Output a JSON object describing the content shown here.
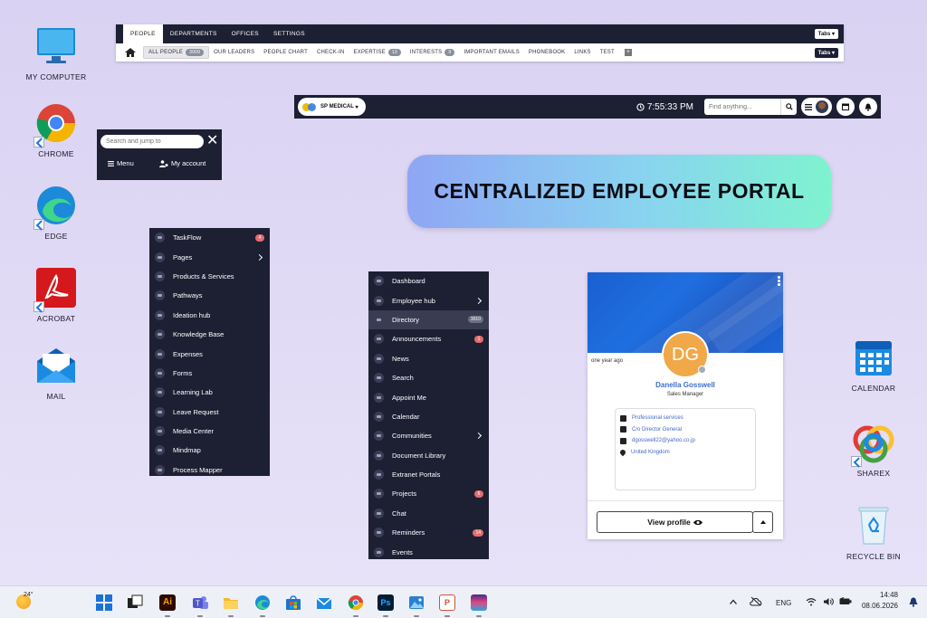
{
  "desktop": {
    "left_icons": [
      {
        "label": "MY COMPUTER"
      },
      {
        "label": "CHROME"
      },
      {
        "label": "EDGE"
      },
      {
        "label": "ACROBAT"
      },
      {
        "label": "MAIL"
      }
    ],
    "right_icons": [
      {
        "label": "CALENDAR"
      },
      {
        "label": "SHAREX"
      },
      {
        "label": "RECYCLE BIN"
      }
    ]
  },
  "tabs_bar": {
    "row1": [
      "PEOPLE",
      "DEPARTMENTS",
      "OFFICES",
      "SETTINGS"
    ],
    "row1_dropdown": "Tabs",
    "row2": [
      {
        "label": "ALL PEOPLE",
        "count": "3009"
      },
      {
        "label": "OUR LEADERS"
      },
      {
        "label": "PEOPLE CHART"
      },
      {
        "label": "CHECK-IN"
      },
      {
        "label": "EXPERTISE",
        "count": "13"
      },
      {
        "label": "INTERESTS",
        "count": "9"
      },
      {
        "label": "IMPORTANT EMAILS"
      },
      {
        "label": "PHONEBOOK"
      },
      {
        "label": "LINKS"
      },
      {
        "label": "TEST"
      }
    ],
    "row2_dropdown": "Tabs"
  },
  "header": {
    "brand": "SP MEDICAL",
    "time": "7:55:33 PM",
    "search_placeholder": "Find anything..."
  },
  "jump": {
    "placeholder": "Search and jump to",
    "menu_label": "Menu",
    "account_label": "My account"
  },
  "banner": {
    "title": "CENTRALIZED EMPLOYEE PORTAL"
  },
  "menu_left": {
    "items": [
      {
        "label": "TaskFlow",
        "badge": "4"
      },
      {
        "label": "Pages",
        "chevron": true
      },
      {
        "label": "Products & Services"
      },
      {
        "label": "Pathways"
      },
      {
        "label": "Ideation hub"
      },
      {
        "label": "Knowledge Base"
      },
      {
        "label": "Expenses"
      },
      {
        "label": "Forms"
      },
      {
        "label": "Learning Lab"
      },
      {
        "label": "Leave Request"
      },
      {
        "label": "Media Center"
      },
      {
        "label": "Mindmap"
      },
      {
        "label": "Process Mapper"
      }
    ]
  },
  "menu_mid": {
    "items": [
      {
        "label": "Dashboard"
      },
      {
        "label": "Employee hub",
        "chevron": true
      },
      {
        "label": "Directory",
        "badge": "3010",
        "grey": true,
        "active": true
      },
      {
        "label": "Announcements",
        "badge": "1"
      },
      {
        "label": "News"
      },
      {
        "label": "Search"
      },
      {
        "label": "Appoint Me"
      },
      {
        "label": "Calendar"
      },
      {
        "label": "Communities",
        "chevron": true
      },
      {
        "label": "Document Library"
      },
      {
        "label": "Extranet Portals"
      },
      {
        "label": "Projects",
        "badge": "6"
      },
      {
        "label": "Chat"
      },
      {
        "label": "Reminders",
        "badge": "14"
      },
      {
        "label": "Events"
      }
    ]
  },
  "profile": {
    "initials": "DG",
    "ago": "one year ago",
    "name": "Danella Gosswell",
    "role": "Sales Manager",
    "details": [
      "Professional services",
      "C/o Director General",
      "dgosswell22@yahoo.co.jp",
      "United Kingdom"
    ],
    "view_label": "View profile"
  },
  "taskbar": {
    "weather": "24°",
    "lang": "ENG",
    "time": "14:48",
    "date": "08.06.2026"
  },
  "colors": {
    "dark_navy": "#1d1f33",
    "badge_red": "#e26d6d",
    "avatar_orange": "#f0a849",
    "hero_blue": "#1a5fd1"
  }
}
